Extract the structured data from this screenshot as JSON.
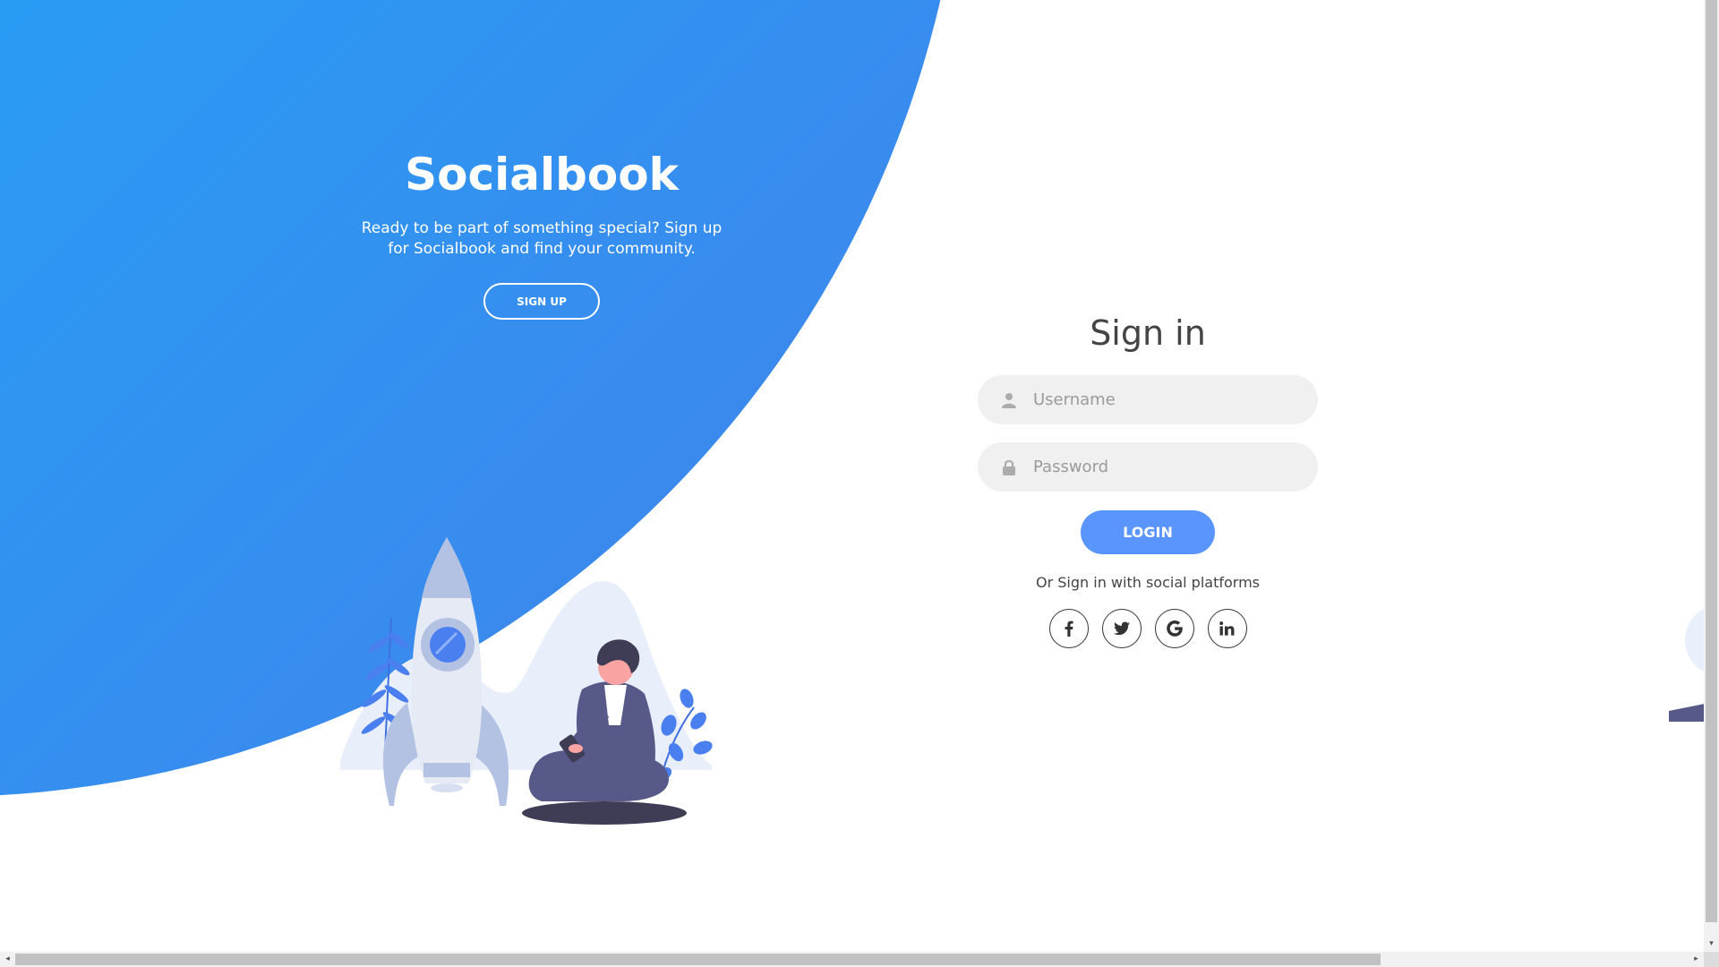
{
  "brand": {
    "title": "Socialbook",
    "description": "Ready to be part of something special? Sign up for Socialbook and find your community.",
    "signup_label": "SIGN UP"
  },
  "signin": {
    "title": "Sign in",
    "username_placeholder": "Username",
    "password_placeholder": "Password",
    "login_label": "LOGIN",
    "social_text": "Or Sign in with social platforms"
  },
  "social": [
    {
      "icon": "facebook-icon",
      "glyph": "f"
    },
    {
      "icon": "twitter-icon",
      "glyph": "bird"
    },
    {
      "icon": "google-icon",
      "glyph": "G"
    },
    {
      "icon": "linkedin-icon",
      "glyph": "in"
    }
  ],
  "colors": {
    "brand_gradient_start": "#04befe",
    "brand_gradient_end": "#4481eb",
    "login_button": "#5995fd",
    "input_background": "#f0f0f0",
    "illustration_accent": "#575a89"
  },
  "scrollbars": {
    "up_arrow": "▴",
    "down_arrow": "▾",
    "left_arrow": "◂",
    "right_arrow": "▸"
  }
}
